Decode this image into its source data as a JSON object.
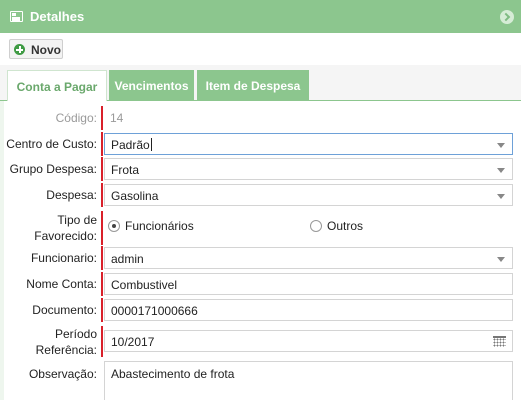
{
  "window": {
    "title": "Detalhes"
  },
  "toolbar": {
    "new_label": "Novo"
  },
  "tabs": [
    {
      "label": "Conta a Pagar",
      "active": true
    },
    {
      "label": "Vencimentos",
      "active": false
    },
    {
      "label": "Item de Despesa",
      "active": false
    }
  ],
  "form": {
    "codigo": {
      "label": "Código:",
      "value": "14"
    },
    "centro_custo": {
      "label": "Centro de Custo:",
      "value": "Padrão"
    },
    "grupo_despesa": {
      "label": "Grupo Despesa:",
      "value": "Frota"
    },
    "despesa": {
      "label": "Despesa:",
      "value": "Gasolina"
    },
    "tipo_favorecido": {
      "label_line1": "Tipo de",
      "label_line2": "Favorecido:",
      "options": [
        {
          "label": "Funcionários",
          "checked": true
        },
        {
          "label": "Outros",
          "checked": false
        }
      ]
    },
    "funcionario": {
      "label": "Funcionario:",
      "value": "admin"
    },
    "nome_conta": {
      "label": "Nome Conta:",
      "value": "Combustivel"
    },
    "documento": {
      "label": "Documento:",
      "value": "0000171000666"
    },
    "periodo_referencia": {
      "label_line1": "Período",
      "label_line2": "Referência:",
      "value": "10/2017"
    },
    "observacao": {
      "label": "Observação:",
      "value": "Abastecimento de frota"
    }
  },
  "colors": {
    "accent_green": "#8cc68e",
    "required_marker": "#d9202a",
    "new_button_icon": "#3e9a43"
  },
  "icons": [
    "window-icon",
    "collapse-icon",
    "plus-icon",
    "dropdown-caret-icon",
    "calendar-icon"
  ]
}
